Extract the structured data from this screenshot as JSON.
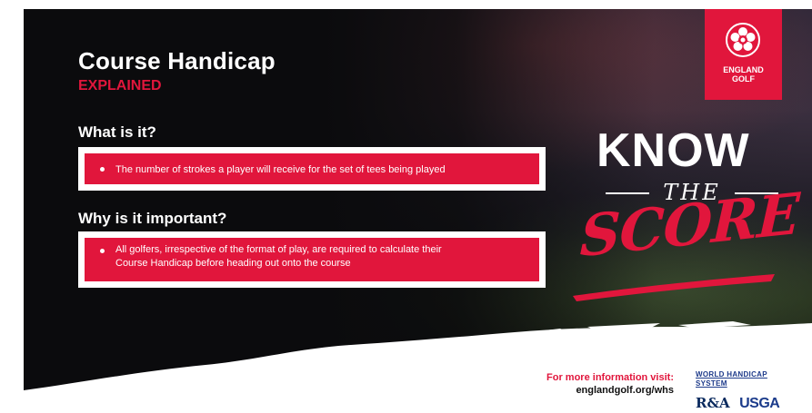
{
  "header": {
    "title": "Course Handicap",
    "subtitle": "EXPLAINED"
  },
  "sections": [
    {
      "question": "What is it?",
      "answer": "The number of strokes a player will receive for the set of tees being played"
    },
    {
      "question": "Why is it important?",
      "answer_line1": "All golfers, irrespective of the format of play, are required to calculate their",
      "answer_line2": "Course Handicap before heading out onto the course"
    }
  ],
  "logo": {
    "line1": "ENGLAND",
    "line2": "GOLF",
    "icon": "rose-icon"
  },
  "campaign": {
    "know": "KNOW",
    "the": "THE",
    "score": "SCORE"
  },
  "footer": {
    "info_label": "For more information visit:",
    "url": "englandgolf.org/whs",
    "whs_title": "WORLD HANDICAP SYSTEM",
    "partner1": "R&A",
    "partner2": "USGA"
  },
  "colors": {
    "brand_red": "#e1163c",
    "background": "#0a0a0c",
    "whs_blue": "#1d3a8a"
  }
}
